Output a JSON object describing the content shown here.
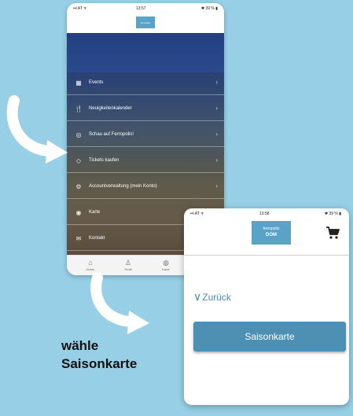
{
  "phone1": {
    "status": {
      "left": "••l AT ᯤ",
      "time": "13:57",
      "right": "✱ 39 % ▮"
    },
    "logo_text": "ferropolis",
    "menu": [
      {
        "icon": "calendar-icon",
        "glyph": "▦",
        "label": "Events"
      },
      {
        "icon": "cutlery-icon",
        "glyph": "🍴",
        "label": "Neuigkeitenkalender"
      },
      {
        "icon": "binoculars-icon",
        "glyph": "◎",
        "label": "Schau auf Ferropolis!"
      },
      {
        "icon": "ticket-icon",
        "glyph": "◇",
        "label": "Tickets kaufen"
      },
      {
        "icon": "settings-icon",
        "glyph": "⚙",
        "label": "Accountverwaltung (mein Konto)"
      },
      {
        "icon": "map-icon",
        "glyph": "◉",
        "label": "Karte"
      },
      {
        "icon": "contact-icon",
        "glyph": "✉",
        "label": "Kontakt"
      }
    ],
    "tabs": [
      {
        "icon": "home-icon",
        "glyph": "⌂",
        "label": "Home"
      },
      {
        "icon": "profile-icon",
        "glyph": "♙",
        "label": "Profil"
      },
      {
        "icon": "location-icon",
        "glyph": "◍",
        "label": "Karte"
      },
      {
        "icon": "shop-icon",
        "glyph": "◈",
        "label": "Shop"
      }
    ]
  },
  "phone2": {
    "status": {
      "left": "••l AT ᯤ",
      "time": "13:58",
      "right": "✱ 39 % ▮"
    },
    "logo_top": "ferropolis",
    "logo_bottom": "DOM",
    "back_chevron": "∨",
    "back_label": "Zurück",
    "season_button_label": "Saisonkarte"
  },
  "caption": {
    "line1": "wähle",
    "line2": "Saisonkarte"
  },
  "colors": {
    "background": "#96cfe6",
    "header_blue": "#233f82",
    "accent": "#4d90b3",
    "arrow": "#ffffff"
  }
}
